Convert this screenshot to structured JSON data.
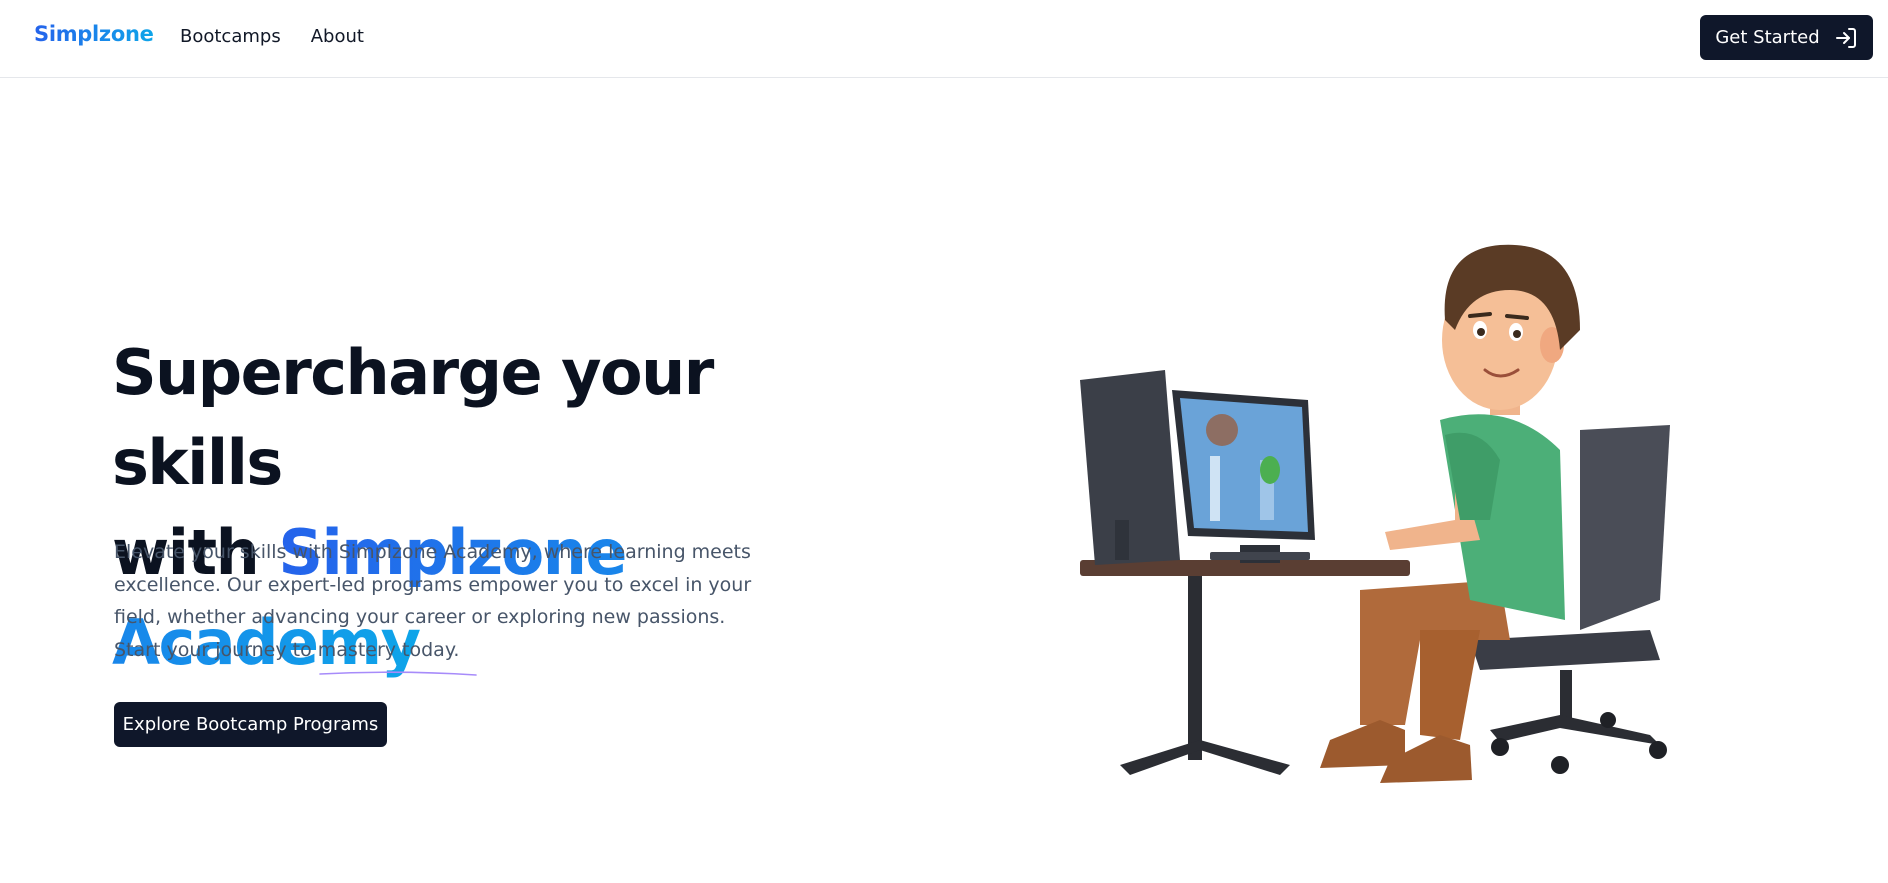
{
  "header": {
    "logo": "Simplzone",
    "nav": [
      "Bootcamps",
      "About"
    ],
    "cta_label": "Get Started",
    "cta_icon": "sign-in-icon"
  },
  "hero": {
    "title_line1": "Supercharge your skills",
    "title_prefix": "with",
    "title_accent": "Simplzone Academy",
    "description": "Elevate your skills with Simplzone Academy, where learning meets excellence. Our expert-led programs empower you to excel in your field, whether advancing your career or exploring new passions. Start your journey to mastery today.",
    "cta_label": "Explore Bootcamp Programs"
  },
  "colors": {
    "brand_dark": "#0f172a",
    "accent_blue": "#2563eb",
    "accent_cyan": "#0ea5e9",
    "underline_purple": "#a78bfa"
  }
}
